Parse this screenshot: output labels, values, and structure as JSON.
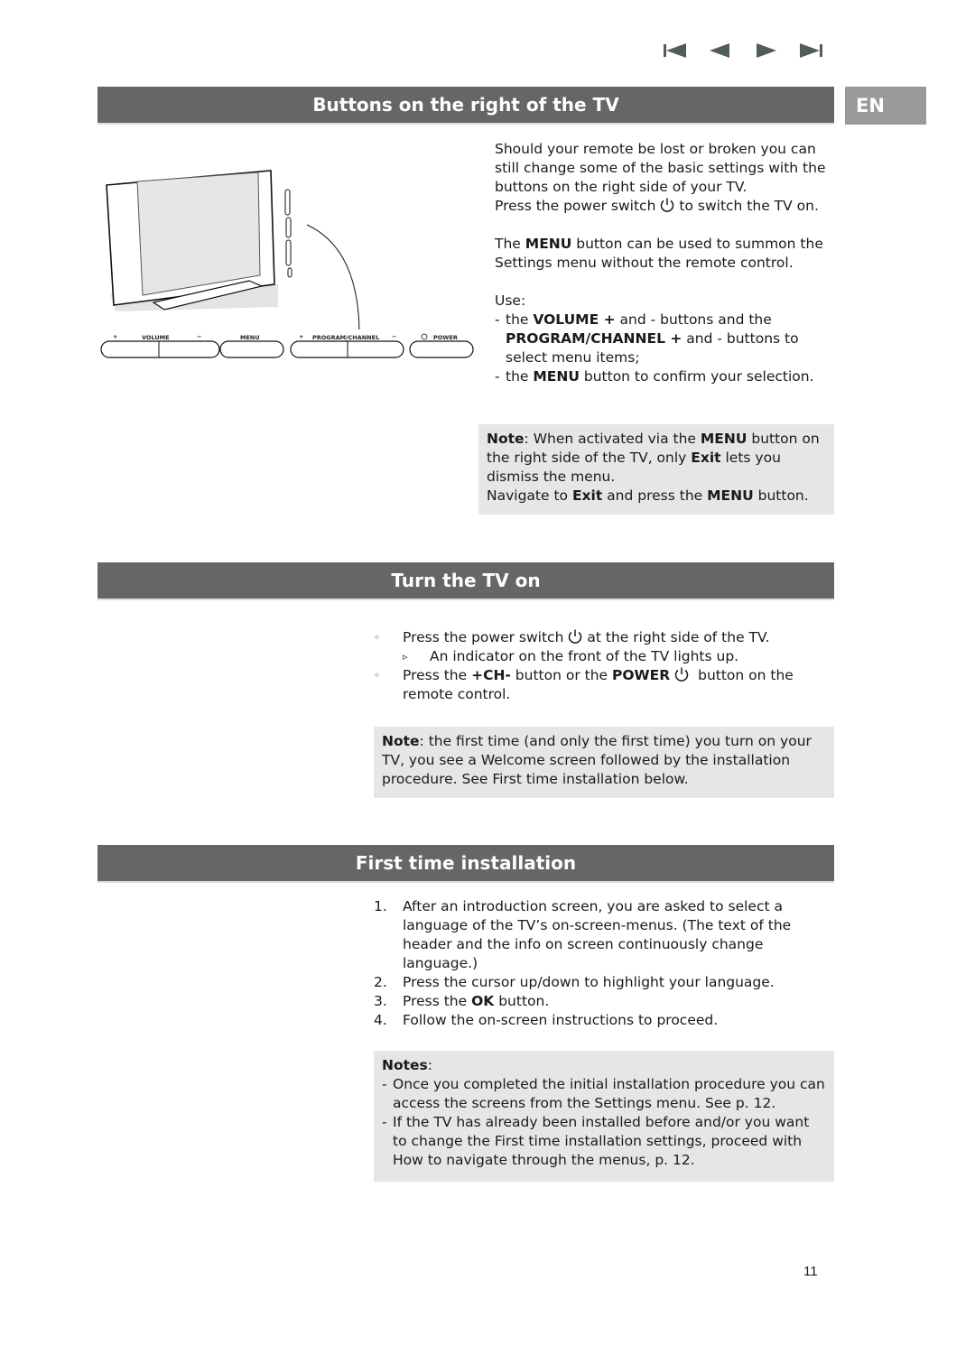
{
  "nav": {
    "first_icon": "first-page-icon",
    "prev_icon": "previous-page-icon",
    "next_icon": "next-page-icon",
    "last_icon": "last-page-icon"
  },
  "language_tag": "EN",
  "colors": {
    "header_bg": "#666666",
    "en_bg": "#999999",
    "note_bg": "#e6e6e6",
    "nav_icon": "#4f5d5d"
  },
  "section1": {
    "title": "Buttons on the right of the TV",
    "illustration": {
      "labels": {
        "plus1": "+",
        "volume": "VOLUME",
        "minus1": "−",
        "menu": "MENU",
        "plus2": "+",
        "program": "PROGRAM/CHANNEL",
        "minus2": "−",
        "power": "POWER"
      }
    },
    "intro_p1": "Should your remote be lost or broken you can still change some of the basic settings with the buttons on the right side of your TV.",
    "intro_p2a": "Press the power switch",
    "intro_p2b": "to switch the TV on.",
    "menu_p_bold": "MENU",
    "menu_p_pre": "The ",
    "menu_p_post": " button can be used to summon the Settings menu without the remote control.",
    "use_label": "Use:",
    "use_items": [
      {
        "mk": "-",
        "pre": "the ",
        "b1": "VOLUME +",
        "mid": " and - buttons and the ",
        "b2": "PROGRAM/CHANNEL +",
        "post": " and -  buttons to select menu items;"
      },
      {
        "mk": "-",
        "pre": "the ",
        "b1": "MENU",
        "post": " button to confirm your selection."
      }
    ],
    "note": {
      "label": "Note",
      "t1": ": When activated via the ",
      "b1": "MENU",
      "t2": " button on the right side of the TV, only ",
      "b2": "Exit",
      "t3": " lets you dismiss the menu.",
      "l2_pre": "Navigate to ",
      "l2_b1": "Exit",
      "l2_mid": " and press the ",
      "l2_b2": "MENU",
      "l2_post": " button."
    }
  },
  "section2": {
    "title": "Turn the TV on",
    "items": [
      {
        "mk": "◦",
        "pre": "Press the power switch",
        "post": "at the right side of the TV."
      },
      {
        "mk": "▹",
        "text": "An indicator on the front of the TV lights up."
      },
      {
        "mk": "◦",
        "pre": "Press the ",
        "b1": "+CH-",
        "mid": " button or the ",
        "b2": "POWER",
        "post": " button on the remote control."
      }
    ],
    "note": {
      "label": "Note",
      "text": ": the first time (and only the first time) you turn on your TV, you see a Welcome screen followed by the installation procedure. See First time installation below."
    }
  },
  "section3": {
    "title": "First time installation",
    "steps": [
      {
        "n": "1.",
        "text": "After an introduction screen, you are asked to select a language of the TV’s on-screen-menus. (The text of the header and the info on screen continuously change language.)"
      },
      {
        "n": "2.",
        "text": "Press the cursor up/down to highlight your language."
      },
      {
        "n": "3.",
        "pre": "Press the ",
        "b": "OK",
        "post": " button."
      },
      {
        "n": "4.",
        "text": "Follow the on-screen instructions to proceed."
      }
    ],
    "notes": {
      "label": "Notes",
      "colon": ":",
      "items": [
        {
          "mk": "-",
          "text": "Once you completed the initial installation procedure you can access the screens from the Settings menu. See p. 12."
        },
        {
          "mk": "-",
          "text": "If the TV has already been installed before and/or you want to change the First time installation settings, proceed with How to navigate through the menus, p. 12."
        }
      ]
    }
  },
  "page_number": "11"
}
